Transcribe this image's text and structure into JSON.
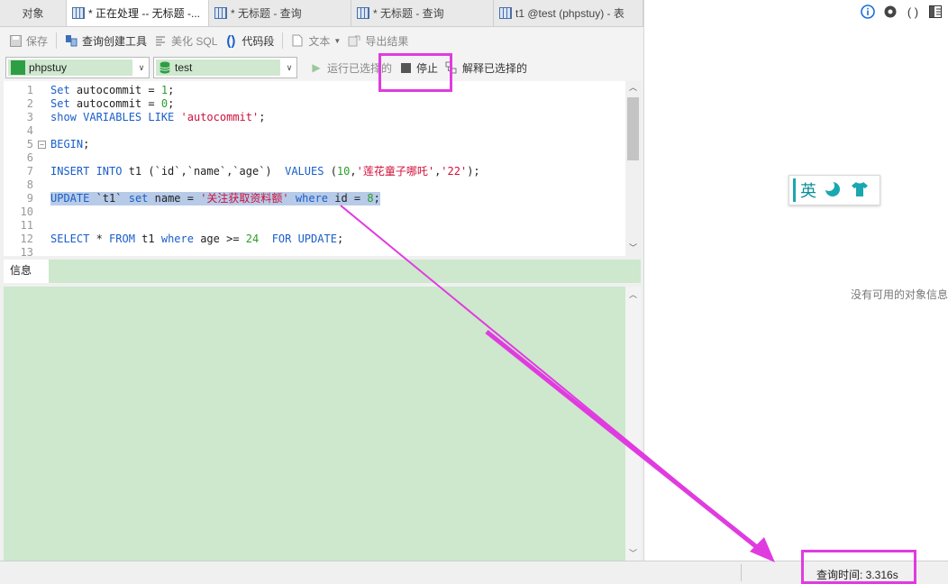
{
  "tabs": [
    {
      "label": "对象",
      "active": false,
      "icon": false
    },
    {
      "label": "* 正在处理 -- 无标题 -...",
      "active": true,
      "icon": true
    },
    {
      "label": "* 无标题 - 查询",
      "active": false,
      "icon": true
    },
    {
      "label": "* 无标题 - 查询",
      "active": false,
      "icon": true
    },
    {
      "label": "t1 @test (phpstuy) - 表",
      "active": false,
      "icon": true
    }
  ],
  "toolbar": {
    "save": "保存",
    "query_builder": "查询创建工具",
    "beautify": "美化 SQL",
    "code_snippet": "代码段",
    "text": "文本",
    "export": "导出结果"
  },
  "connection": {
    "server": "phpstuy",
    "database": "test",
    "run_selected": "运行已选择的",
    "stop": "停止",
    "explain_selected": "解释已选择的"
  },
  "editor": {
    "line_numbers": [
      "1",
      "2",
      "3",
      "4",
      "5",
      "6",
      "7",
      "8",
      "9",
      "10",
      "11",
      "12",
      "13"
    ],
    "lines": [
      [
        {
          "t": "kw",
          "v": "Set"
        },
        {
          "t": "p",
          "v": " autocommit = "
        },
        {
          "t": "num",
          "v": "1"
        },
        {
          "t": "p",
          "v": ";"
        }
      ],
      [
        {
          "t": "kw",
          "v": "Set"
        },
        {
          "t": "p",
          "v": " autocommit = "
        },
        {
          "t": "num",
          "v": "0"
        },
        {
          "t": "p",
          "v": ";"
        }
      ],
      [
        {
          "t": "kw",
          "v": "show VARIABLES LIKE"
        },
        {
          "t": "p",
          "v": " "
        },
        {
          "t": "str",
          "v": "'autocommit'"
        },
        {
          "t": "p",
          "v": ";"
        }
      ],
      [],
      [
        {
          "t": "kw",
          "v": "BEGIN"
        },
        {
          "t": "p",
          "v": ";"
        }
      ],
      [],
      [
        {
          "t": "kw",
          "v": "INSERT INTO"
        },
        {
          "t": "p",
          "v": " t1 (`id`,`name`,`age`)  "
        },
        {
          "t": "kw",
          "v": "VALUES"
        },
        {
          "t": "p",
          "v": " ("
        },
        {
          "t": "num",
          "v": "10"
        },
        {
          "t": "p",
          "v": ","
        },
        {
          "t": "str",
          "v": "'莲花童子哪吒'"
        },
        {
          "t": "p",
          "v": ","
        },
        {
          "t": "str",
          "v": "'22'"
        },
        {
          "t": "p",
          "v": ");"
        }
      ],
      [],
      [
        {
          "t": "kw",
          "v": "UPDATE"
        },
        {
          "t": "p",
          "v": " `t1` "
        },
        {
          "t": "kw",
          "v": "set"
        },
        {
          "t": "p",
          "v": " name = "
        },
        {
          "t": "str",
          "v": "'关注获取资料额'"
        },
        {
          "t": "p",
          "v": " "
        },
        {
          "t": "kw",
          "v": "where"
        },
        {
          "t": "p",
          "v": " id = "
        },
        {
          "t": "num",
          "v": "8"
        },
        {
          "t": "p",
          "v": ";"
        }
      ],
      [],
      [],
      [
        {
          "t": "kw",
          "v": "SELECT"
        },
        {
          "t": "p",
          "v": " * "
        },
        {
          "t": "kw",
          "v": "FROM"
        },
        {
          "t": "p",
          "v": " t1 "
        },
        {
          "t": "kw",
          "v": "where"
        },
        {
          "t": "p",
          "v": " age >= "
        },
        {
          "t": "num",
          "v": "24"
        },
        {
          "t": "p",
          "v": "  "
        },
        {
          "t": "kw",
          "v": "FOR UPDATE"
        },
        {
          "t": "p",
          "v": ";"
        }
      ],
      []
    ],
    "selected_line": 9,
    "fold_lines": [
      5
    ]
  },
  "info_panel": {
    "tab": "信息"
  },
  "right_panel": {
    "icons": [
      "info-icon",
      "eye-icon",
      "brackets-icon",
      "columns-icon"
    ],
    "no_info": "没有可用的对象信息",
    "ime_lang": "英"
  },
  "status": {
    "query_time": "查询时间: 3.316s"
  },
  "colors": {
    "keyword": "#1a5ec9",
    "number": "#2a9d2a",
    "string": "#d0103a",
    "selection": "#b7cbe8",
    "info_bg": "#cde8cd",
    "annotation": "#e03be0"
  }
}
